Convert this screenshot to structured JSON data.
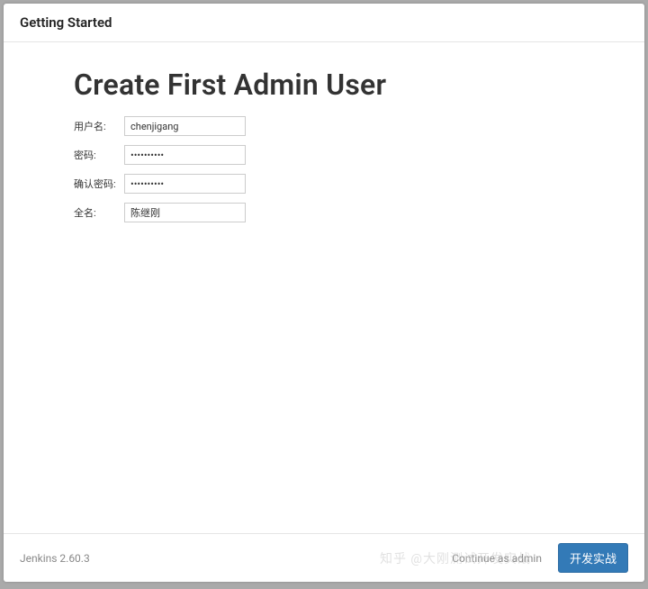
{
  "header": {
    "title": "Getting Started"
  },
  "main": {
    "heading": "Create First Admin User",
    "form": {
      "username_label": "用户名:",
      "username_value": "chenjigang",
      "password_label": "密码:",
      "password_value": "••••••••••",
      "confirm_label": "确认密码:",
      "confirm_value": "••••••••••",
      "fullname_label": "全名:",
      "fullname_value": "陈继刚"
    }
  },
  "footer": {
    "version": "Jenkins 2.60.3",
    "continue_as_admin": "Continue as admin",
    "save_and_finish": "开发实战"
  },
  "watermark": "知乎 @大刚测试开发实战"
}
